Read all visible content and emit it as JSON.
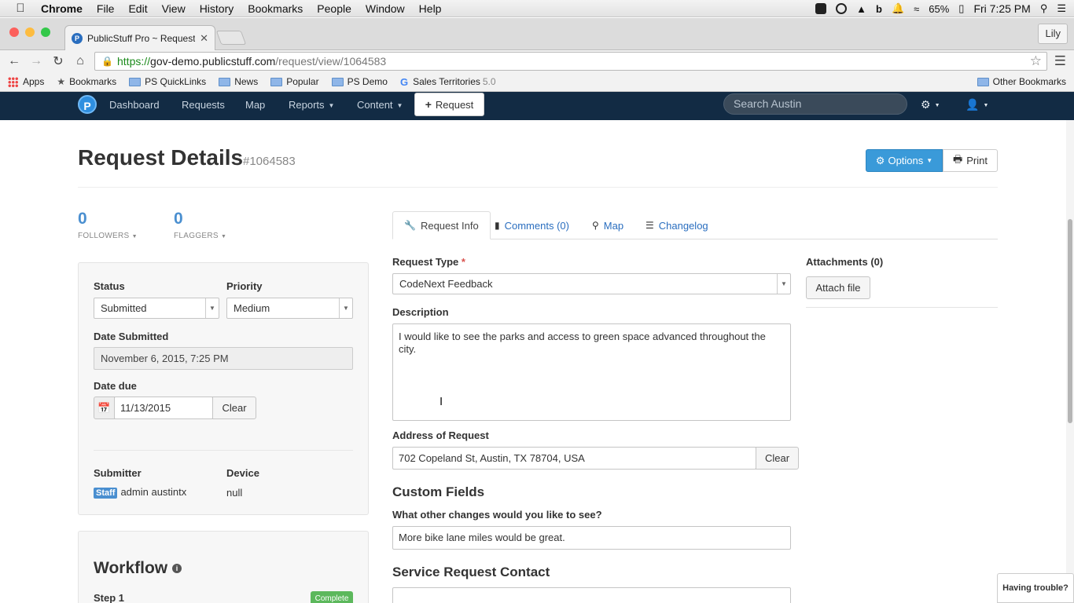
{
  "mac": {
    "app": "Chrome",
    "menus": [
      "File",
      "Edit",
      "View",
      "History",
      "Bookmarks",
      "People",
      "Window",
      "Help"
    ],
    "battery": "65%",
    "clock": "Fri 7:25 PM"
  },
  "browser": {
    "tab_title": "PublicStuff Pro ~ Request",
    "profile": "Lily",
    "url_scheme": "https://",
    "url_host": "gov-demo.publicstuff.com",
    "url_path": "/request/view/1064583",
    "bookmarks": [
      "Apps",
      "Bookmarks",
      "PS QuickLinks",
      "News",
      "Popular",
      "PS Demo",
      "Sales Territories"
    ],
    "bookmark_version": "5.0",
    "other_bookmarks": "Other Bookmarks"
  },
  "nav": {
    "logo": "P",
    "items": [
      "Dashboard",
      "Requests",
      "Map",
      "Reports",
      "Content"
    ],
    "request_button": "Request",
    "search_placeholder": "Search Austin"
  },
  "page": {
    "title": "Request Details",
    "request_id": "#1064583",
    "options": "Options",
    "print": "Print"
  },
  "counters": {
    "followers": {
      "value": "0",
      "label": "FOLLOWERS"
    },
    "flaggers": {
      "value": "0",
      "label": "FLAGGERS"
    }
  },
  "sidebar": {
    "status_label": "Status",
    "status_value": "Submitted",
    "priority_label": "Priority",
    "priority_value": "Medium",
    "date_submitted_label": "Date Submitted",
    "date_submitted_value": "November 6, 2015, 7:25 PM",
    "date_due_label": "Date due",
    "date_due_value": "11/13/2015",
    "clear": "Clear",
    "submitter_label": "Submitter",
    "submitter_badge": "Staff",
    "submitter_value": "admin austintx",
    "device_label": "Device",
    "device_value": "null",
    "workflow_title": "Workflow",
    "step_label": "Step 1",
    "step_badge": "Complete"
  },
  "tabs": [
    {
      "label": "Request Info"
    },
    {
      "label": "Comments (0)"
    },
    {
      "label": "Map"
    },
    {
      "label": "Changelog"
    }
  ],
  "form": {
    "request_type_label": "Request Type",
    "request_type_value": "CodeNext Feedback",
    "description_label": "Description",
    "description_value": "I would like to see the parks and access to green space advanced throughout the city.",
    "address_label": "Address of Request",
    "address_value": "702 Copeland St, Austin, TX 78704, USA",
    "address_clear": "Clear",
    "custom_fields_title": "Custom Fields",
    "custom_q_label": "What other changes would you like to see?",
    "custom_q_value": "More bike lane miles would be great.",
    "contact_title": "Service Request Contact"
  },
  "attachments": {
    "title": "Attachments (0)",
    "button": "Attach file"
  },
  "help": {
    "trouble": "Having trouble?"
  },
  "colors": {
    "navbar": "#122b44",
    "primary": "#3a9ad9",
    "link": "#2a6ebf",
    "success": "#5cb85c"
  }
}
